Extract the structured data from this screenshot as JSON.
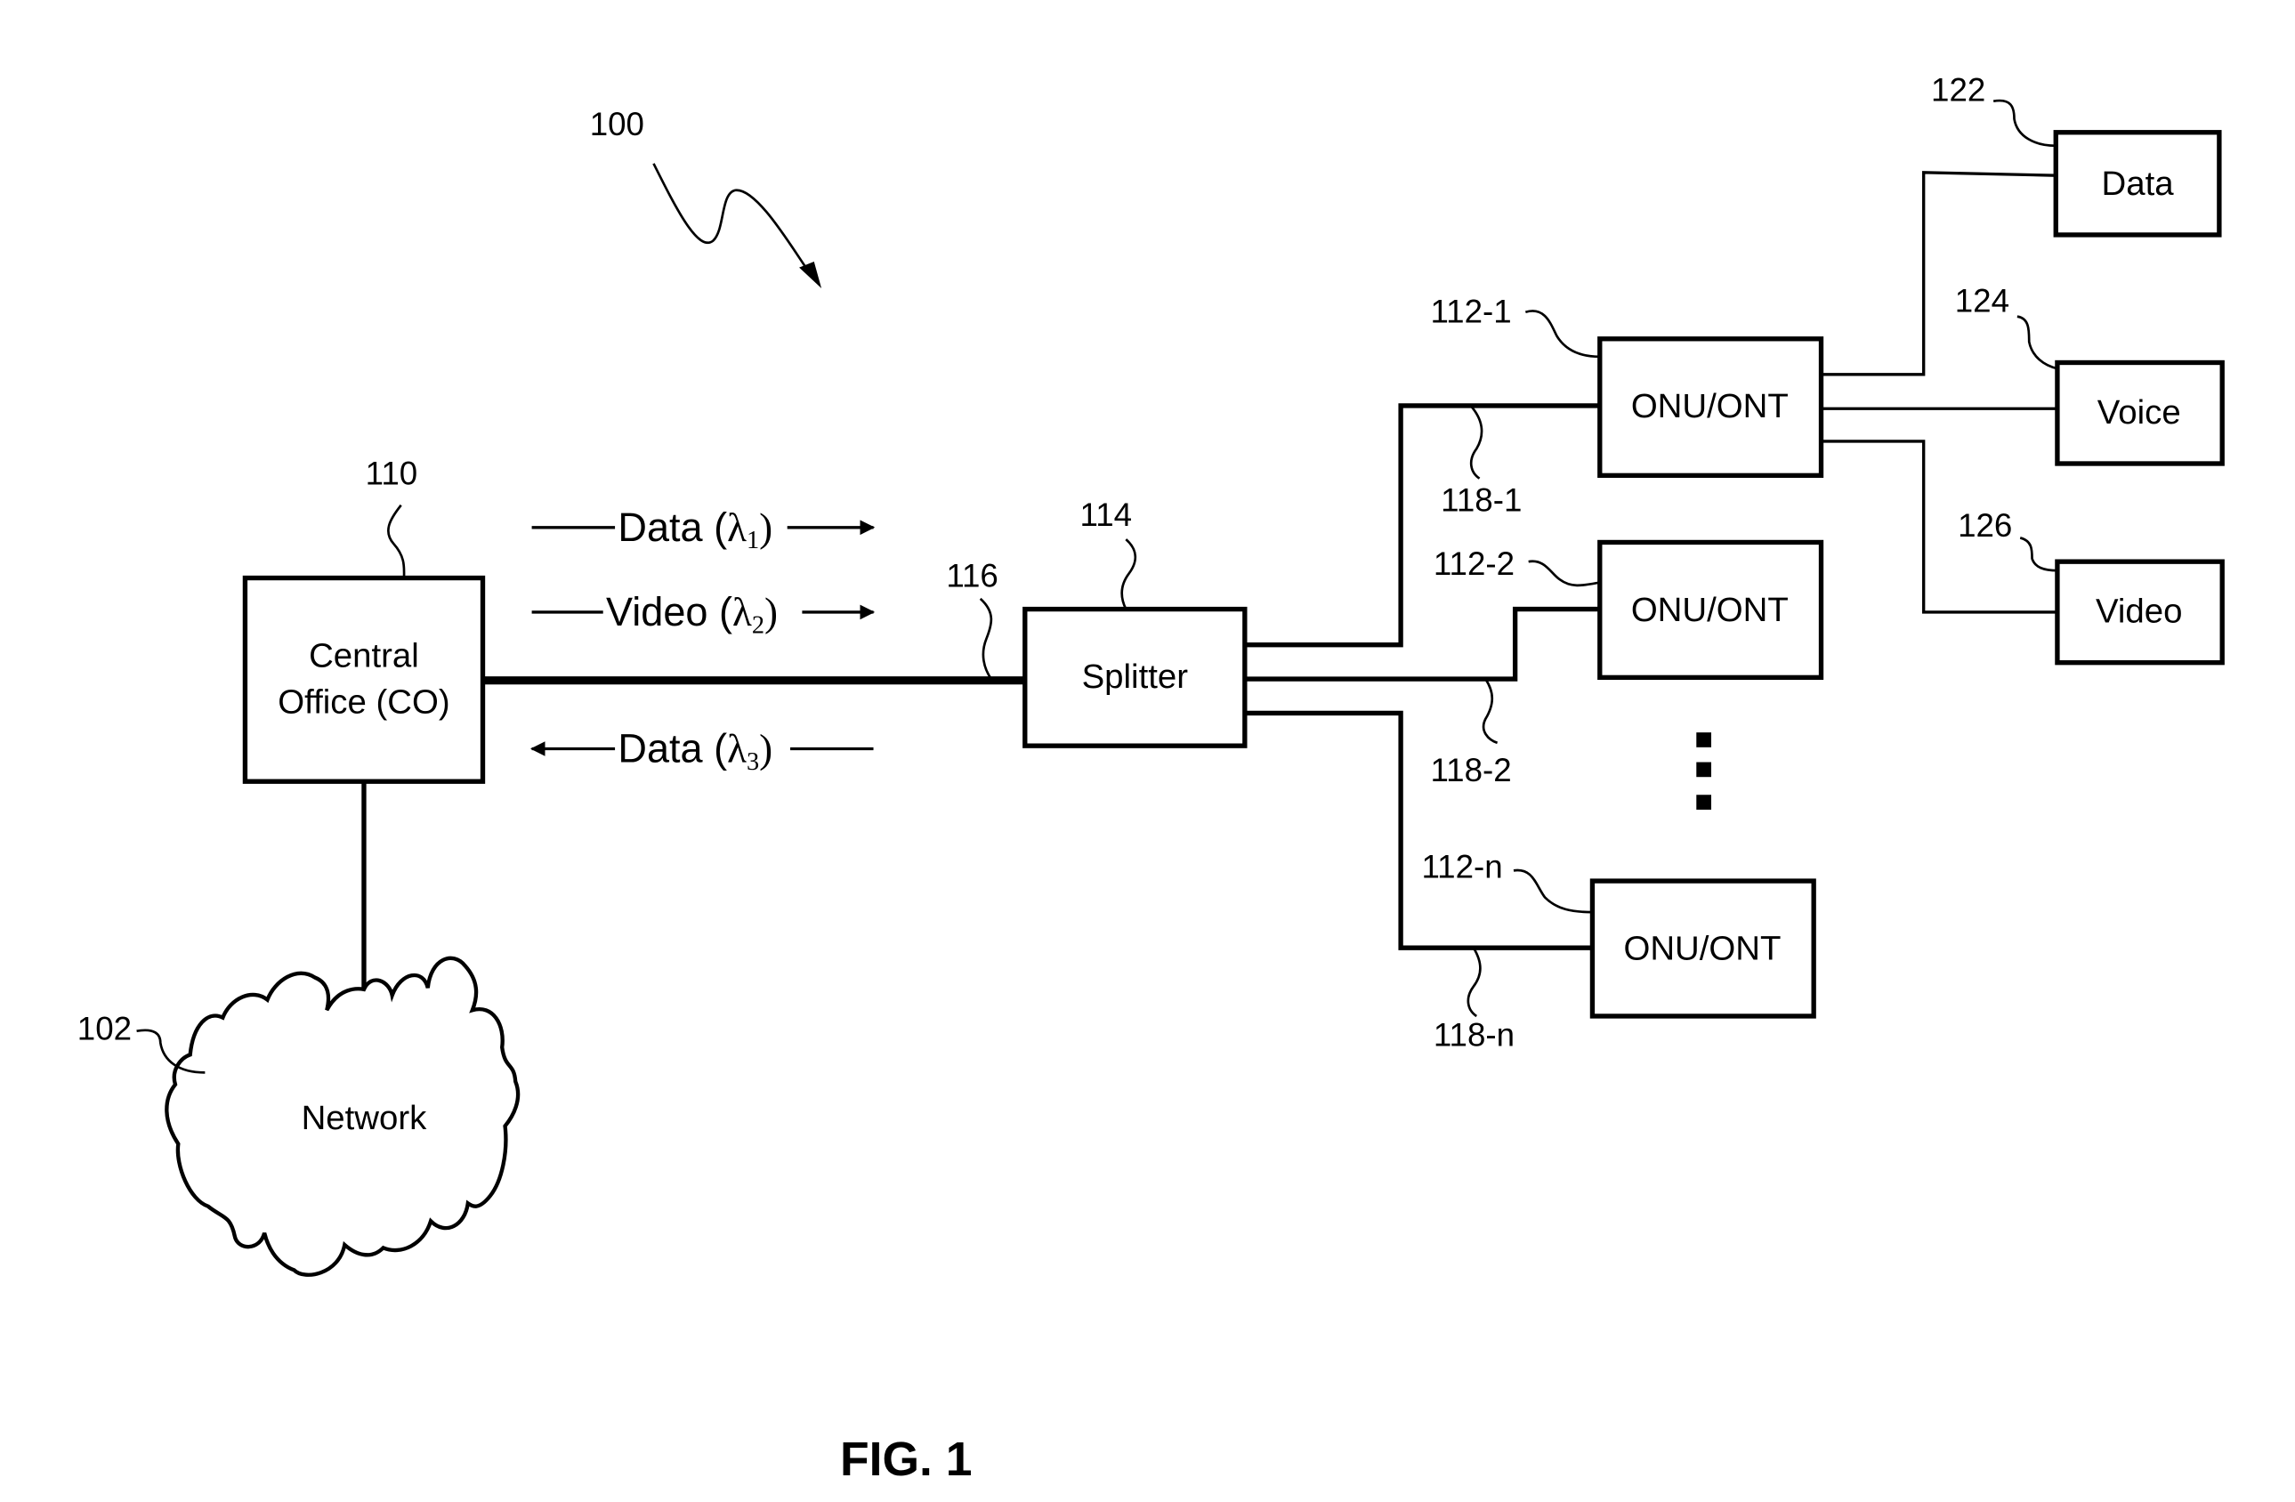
{
  "figure": {
    "caption": "FIG. 1",
    "system_ref": "100"
  },
  "central_office": {
    "ref": "110",
    "label_line1": "Central",
    "label_line2": "Office (CO)"
  },
  "network": {
    "ref": "102",
    "label": "Network"
  },
  "feeder_fiber": {
    "ref": "116"
  },
  "splitter": {
    "ref": "114",
    "label": "Splitter"
  },
  "signals": [
    {
      "name": "Data",
      "wavelength_symbol": "λ",
      "subscript": "1",
      "direction": "downstream"
    },
    {
      "name": "Video",
      "wavelength_symbol": "λ",
      "subscript": "2",
      "direction": "downstream"
    },
    {
      "name": "Data",
      "wavelength_symbol": "λ",
      "subscript": "3",
      "direction": "upstream"
    }
  ],
  "onus": [
    {
      "ref": "112-1",
      "label": "ONU/ONT",
      "fiber_ref": "118-1"
    },
    {
      "ref": "112-2",
      "label": "ONU/ONT",
      "fiber_ref": "118-2"
    },
    {
      "ref": "112-n",
      "label": "ONU/ONT",
      "fiber_ref": "118-n"
    }
  ],
  "devices": [
    {
      "ref": "122",
      "label": "Data"
    },
    {
      "ref": "124",
      "label": "Voice"
    },
    {
      "ref": "126",
      "label": "Video"
    }
  ],
  "colors": {
    "ink": "#000000",
    "background": "#ffffff"
  }
}
